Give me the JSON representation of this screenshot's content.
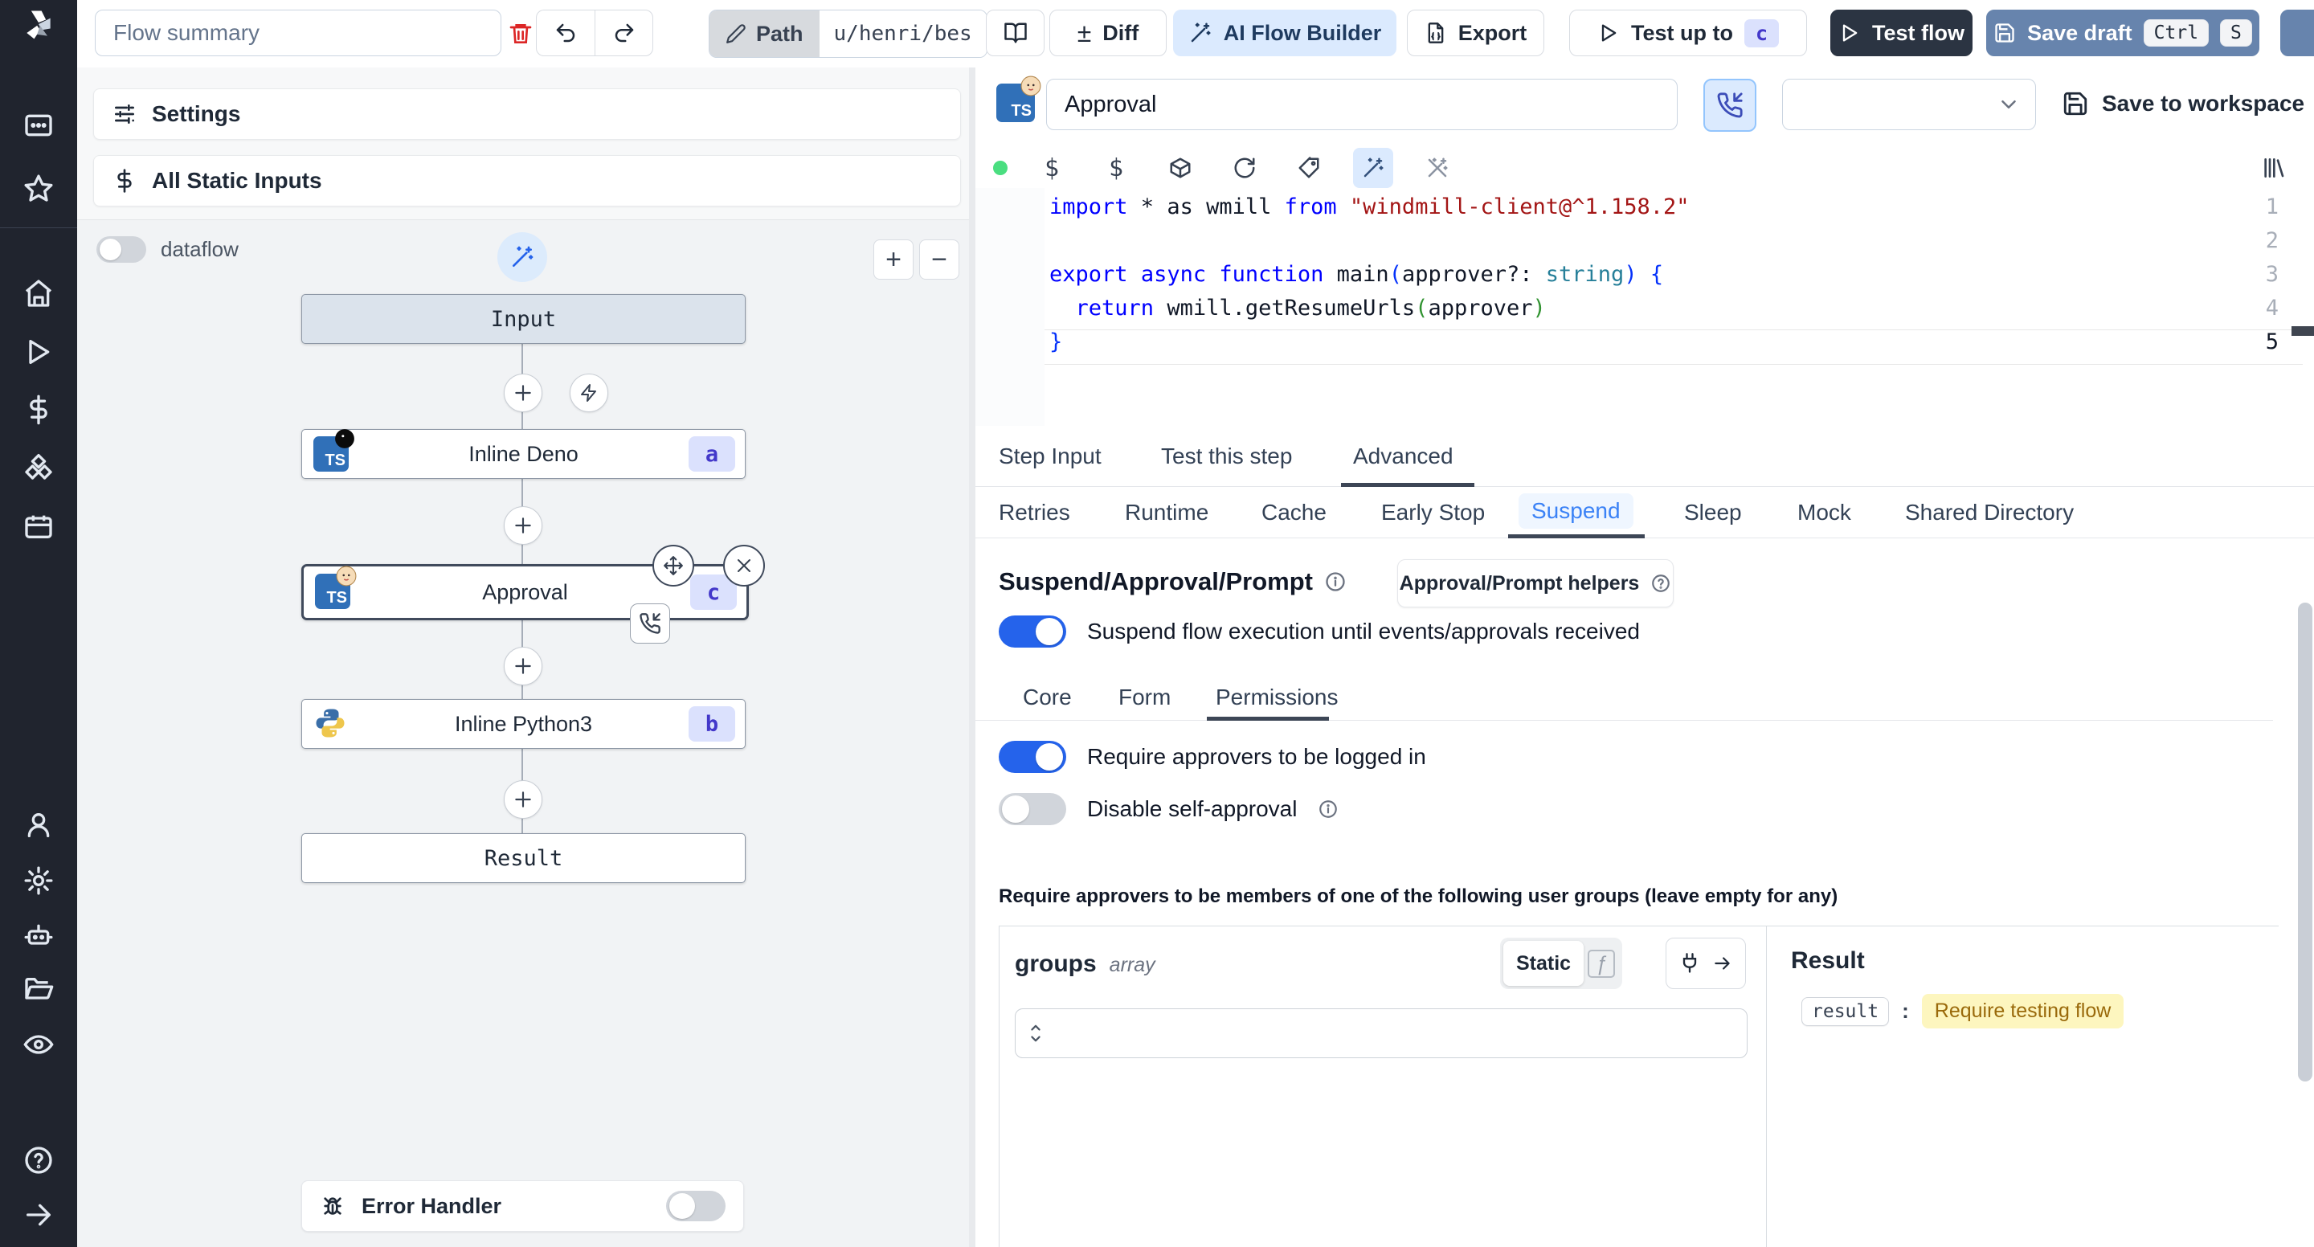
{
  "topbar": {
    "flow_summary_placeholder": "Flow summary",
    "path": {
      "label": "Path",
      "value": "u/henri/bes"
    },
    "diff_label": "Diff",
    "ai_flow_builder_label": "AI Flow Builder",
    "export_label": "Export",
    "test_up_to": {
      "label": "Test up to",
      "badge": "c"
    },
    "test_flow_label": "Test flow",
    "save_draft": {
      "label": "Save draft",
      "kbd_ctrl": "Ctrl",
      "kbd_s": "S"
    }
  },
  "sidebar": {
    "icons": [
      "windmill-logo",
      "app-switcher",
      "star",
      "home",
      "runs",
      "variables",
      "resources",
      "schedules",
      "users",
      "settings",
      "workers",
      "folders",
      "audit-eye",
      "help",
      "expand-arrow"
    ]
  },
  "flow_panel": {
    "settings_label": "Settings",
    "static_inputs_label": "All Static Inputs",
    "dataflow_label": "dataflow",
    "zoom_in": "+",
    "zoom_out": "−",
    "nodes": {
      "input_label": "Input",
      "steps": [
        {
          "label": "Inline Deno",
          "badge": "a",
          "lang": "deno",
          "selected": false
        },
        {
          "label": "Approval",
          "badge": "c",
          "lang": "deno",
          "selected": true
        },
        {
          "label": "Inline Python3",
          "badge": "b",
          "lang": "python3",
          "selected": false
        }
      ],
      "result_label": "Result"
    },
    "error_handler_label": "Error Handler",
    "error_handler_on": false
  },
  "step_editor": {
    "title_value": "Approval",
    "save_to_workspace_label": "Save to workspace",
    "code": {
      "lines": [
        [
          [
            "k",
            "import"
          ],
          [
            "d",
            " * as wmill "
          ],
          [
            "k",
            "from"
          ],
          [
            "s",
            " \"windmill-client@^1.158.2\""
          ]
        ],
        [],
        [
          [
            "k",
            "export"
          ],
          [
            "d",
            " "
          ],
          [
            "k",
            "async"
          ],
          [
            "d",
            " "
          ],
          [
            "k",
            "function"
          ],
          [
            "d",
            " main"
          ],
          [
            "p",
            "("
          ],
          [
            "d",
            "approver?: "
          ],
          [
            "t",
            "string"
          ],
          [
            "p",
            ")"
          ],
          [
            "d",
            " "
          ],
          [
            "p",
            "{"
          ]
        ],
        [
          [
            "d",
            "  "
          ],
          [
            "k",
            "return"
          ],
          [
            "d",
            " wmill.getResumeUrls"
          ],
          [
            "g",
            "("
          ],
          [
            "d",
            "approver"
          ],
          [
            "g",
            ")"
          ]
        ],
        [
          [
            "p",
            "}"
          ]
        ]
      ],
      "line_numbers": [
        "1",
        "2",
        "3",
        "4",
        "5"
      ]
    },
    "tabs": [
      {
        "label": "Step Input"
      },
      {
        "label": "Test this step"
      },
      {
        "label": "Advanced",
        "active": true
      }
    ],
    "advanced_tabs": [
      {
        "label": "Retries"
      },
      {
        "label": "Runtime"
      },
      {
        "label": "Cache"
      },
      {
        "label": "Early Stop"
      },
      {
        "label": "Suspend",
        "active": true
      },
      {
        "label": "Sleep"
      },
      {
        "label": "Mock"
      },
      {
        "label": "Shared Directory"
      }
    ],
    "suspend": {
      "title": "Suspend/Approval/Prompt",
      "helpers_button_label": "Approval/Prompt helpers",
      "suspend_toggle_label": "Suspend flow execution until events/approvals received",
      "suspend_toggle_on": true,
      "perm_tabs": [
        {
          "label": "Core"
        },
        {
          "label": "Form"
        },
        {
          "label": "Permissions",
          "active": true
        }
      ],
      "require_login_label": "Require approvers to be logged in",
      "require_login_on": true,
      "disable_self_label": "Disable self-approval",
      "disable_self_on": false,
      "groups_note": "Require approvers to be members of one of the following user groups (leave empty for any)",
      "groups_field": {
        "name": "groups",
        "type": "array",
        "mode": "Static",
        "fn_glyph": "ƒ"
      },
      "result_panel": {
        "title": "Result",
        "key": "result",
        "value": "Require testing flow"
      }
    }
  },
  "colors": {
    "accent_blue": "#2563eb",
    "save_draft_blue": "#6784ad",
    "badge_bg": "#dbe1fd",
    "badge_text": "#4338ca",
    "result_badge_bg": "#fdf6bf",
    "result_badge_text": "#9a6a0b",
    "status_dot_green": "#4ade80"
  }
}
